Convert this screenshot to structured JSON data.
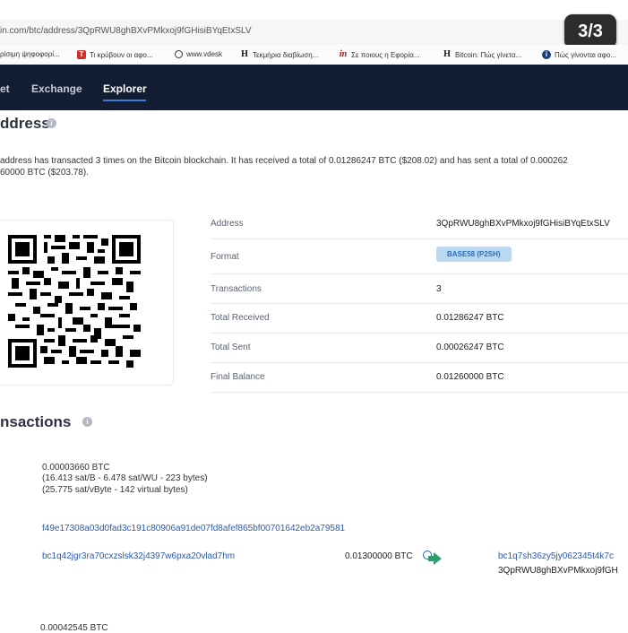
{
  "browser": {
    "url": "in.com/btc/address/3QpRWU8ghBXvPMkxoj9fGHisiBYqEtxSLV",
    "page_counter": "3/3",
    "bookmarks": [
      {
        "icon": "app-icon",
        "label": "ρίσιμη ψηφοφορί..."
      },
      {
        "icon": "red-app-icon",
        "label": "Τι κρύβουν οι αφο..."
      },
      {
        "icon": "globe-icon",
        "label": "www.vdesk"
      },
      {
        "icon": "h-logo-icon",
        "label": "Τεκμήρια διαβίωση..."
      },
      {
        "icon": "in-logo-icon",
        "label": "Σε ποιους η Εφορία..."
      },
      {
        "icon": "h-logo-icon",
        "label": "Bitcoin: Πώς γίνετα..."
      },
      {
        "icon": "blue-circle-icon",
        "label": "Πώς γίνονται αφο..."
      }
    ]
  },
  "nav": {
    "items": [
      "et",
      "Exchange",
      "Explorer"
    ],
    "active": "Explorer"
  },
  "address_section": {
    "title": "ddress",
    "description_line1": "address has transacted 3 times on the Bitcoin blockchain. It has received a total of 0.01286247 BTC ($208.02) and has sent a total of 0.000262",
    "description_line2": "60000 BTC ($203.78)."
  },
  "info": {
    "address_label": "Address",
    "address_value": "3QpRWU8ghBXvPMkxoj9fGHisiBYqEtxSLV",
    "format_label": "Format",
    "format_value": "BASE58 (P2SH)",
    "transactions_label": "Transactions",
    "transactions_value": "3",
    "received_label": "Total Received",
    "received_value": "0.01286247 BTC",
    "sent_label": "Total Sent",
    "sent_value": "0.00026247 BTC",
    "balance_label": "Final Balance",
    "balance_value": "0.01260000 BTC"
  },
  "transactions_section": {
    "title": "nsactions"
  },
  "transaction": {
    "fee": "0.00003660 BTC",
    "fee_rate1": "(16.413 sat/B - 6.478 sat/WU - 223 bytes)",
    "fee_rate2": "(25.775 sat/vByte - 142 virtual bytes)",
    "hash": "f49e17308a03d0fad3c191c80906a91de07fd8afef865bf00701642eb2a79581",
    "from_address": "bc1q42jgr3ra70cxzslsk32j4397w6pxa20vlad7hm",
    "amount": "0.01300000 BTC",
    "to_address1": "bc1q7sh36zy5jy062345t4k7c",
    "to_address2": "3QpRWU8ghBXvPMkxoj9fGH",
    "next_fee_partial": "0.00042545 BTC"
  },
  "colors": {
    "nav_bg": "#121d33",
    "link": "#2e5aa8",
    "badge_bg": "#b9d9f3",
    "arrow": "#2f9d6e"
  }
}
